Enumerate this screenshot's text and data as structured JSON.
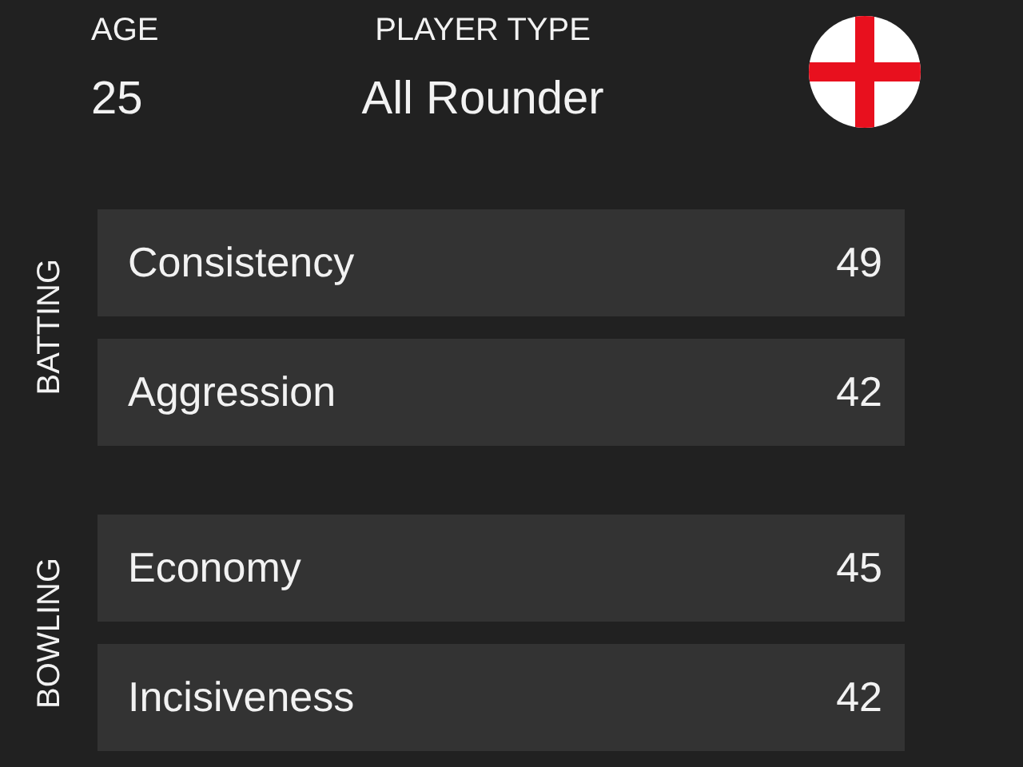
{
  "header": {
    "age_label": "AGE",
    "age": "25",
    "type_label": "PLAYER TYPE",
    "player_type": "All Rounder"
  },
  "sections": [
    {
      "title": "BATTING",
      "stats": [
        {
          "name": "Consistency",
          "value": "49"
        },
        {
          "name": "Aggression",
          "value": "42"
        }
      ]
    },
    {
      "title": "BOWLING",
      "stats": [
        {
          "name": "Economy",
          "value": "45"
        },
        {
          "name": "Incisiveness",
          "value": "42"
        }
      ]
    }
  ]
}
